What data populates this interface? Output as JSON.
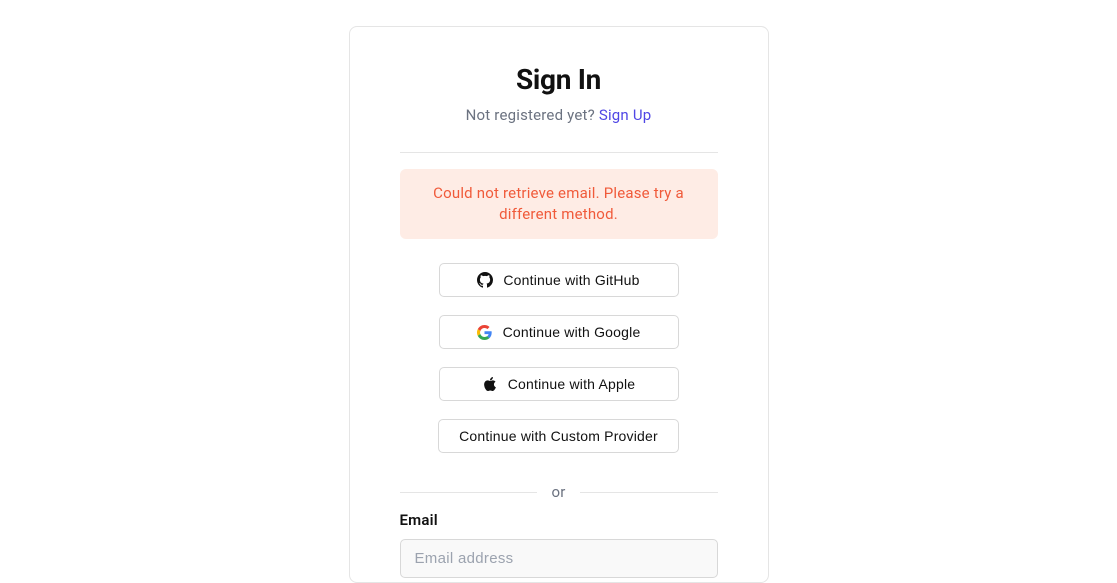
{
  "header": {
    "title": "Sign In",
    "not_registered_text": "Not registered yet? ",
    "signup_link_text": "Sign Up"
  },
  "alert": {
    "message": "Could not retrieve email. Please try a different method."
  },
  "providers": {
    "github_label": "Continue with GitHub",
    "google_label": "Continue with Google",
    "apple_label": "Continue with Apple",
    "custom_label": "Continue with Custom Provider"
  },
  "divider_text": "or",
  "email_section": {
    "label": "Email",
    "placeholder": "Email address",
    "value": ""
  }
}
